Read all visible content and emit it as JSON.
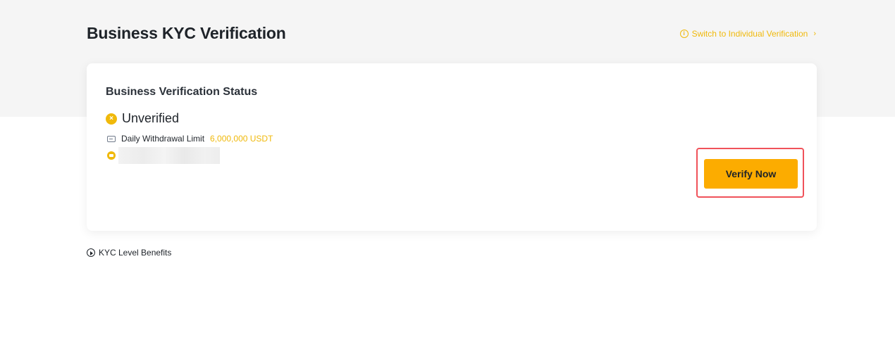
{
  "header": {
    "title": "Business KYC Verification",
    "switch_link_label": "Switch to Individual Verification",
    "switch_link_icon": "info-icon",
    "switch_chevron": "›"
  },
  "status_card": {
    "title": "Business Verification Status",
    "status_icon": "x-circle-icon",
    "status_icon_glyph": "×",
    "status": "Unverified",
    "limit_label": "Daily Withdrawal Limit",
    "limit_value": "6,000,000 USDT",
    "verify_button_label": "Verify Now"
  },
  "footer": {
    "benefits_label": "KYC Level Benefits"
  },
  "colors": {
    "accent": "#f0b90b",
    "button": "#fcac00",
    "highlight_border": "#f0525a",
    "band_background": "#f5f5f5"
  }
}
